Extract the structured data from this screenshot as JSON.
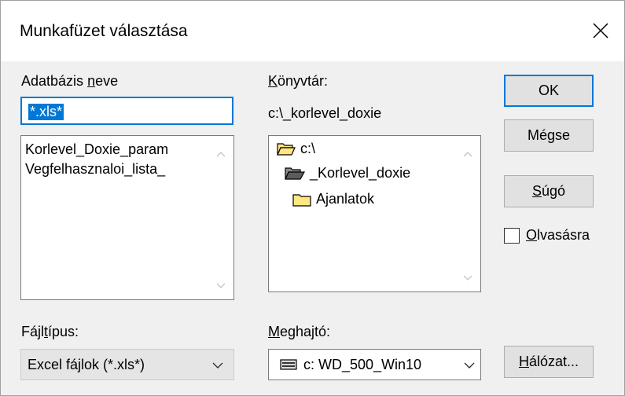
{
  "window": {
    "title": "Munkafüzet választása",
    "close_icon": "close-icon"
  },
  "database": {
    "label_before": "Adatbázis ",
    "label_mnemonic": "n",
    "label_after": "eve",
    "input_value": "*.xls*",
    "files": [
      "Korlevel_Doxie_param",
      "Vegfelhasznaloi_lista_"
    ]
  },
  "directory": {
    "label_mnemonic": "K",
    "label_after": "önyvtár:",
    "current_path": "c:\\_korlevel_doxie",
    "tree": [
      "c:\\",
      "_Korlevel_doxie",
      "Ajanlatok"
    ]
  },
  "filetype": {
    "label_before": "Fájl",
    "label_mnemonic": "t",
    "label_after": "ípus:",
    "selected": "Excel fájlok (*.xls*)"
  },
  "drive": {
    "label_mnemonic": "M",
    "label_after": "eghajtó:",
    "selected": "c: WD_500_Win10"
  },
  "buttons": {
    "ok": "OK",
    "cancel": "Mégse",
    "help_mnemonic": "S",
    "help_after": "úgó",
    "network_mnemonic": "H",
    "network_after": "álózat..."
  },
  "readonly": {
    "label_mnemonic": "O",
    "label_after": "lvasásra",
    "checked": false
  },
  "colors": {
    "accent": "#0078d7",
    "folder": "#ffe680",
    "dialog_bg": "#f0f0f0"
  }
}
